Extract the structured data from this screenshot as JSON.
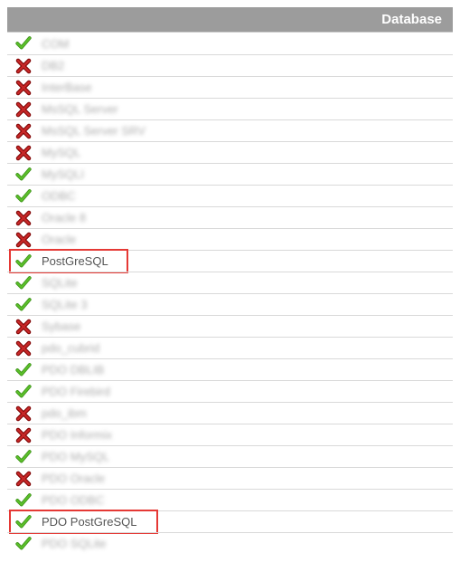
{
  "header": {
    "title": "Database"
  },
  "rows": [
    {
      "status": "ok",
      "label": "COM",
      "blurred": true,
      "highlight": false,
      "hw": 0
    },
    {
      "status": "fail",
      "label": "DB2",
      "blurred": true,
      "highlight": false,
      "hw": 0
    },
    {
      "status": "fail",
      "label": "InterBase",
      "blurred": true,
      "highlight": false,
      "hw": 0
    },
    {
      "status": "fail",
      "label": "MsSQL Server",
      "blurred": true,
      "highlight": false,
      "hw": 0
    },
    {
      "status": "fail",
      "label": "MsSQL Server SRV",
      "blurred": true,
      "highlight": false,
      "hw": 0
    },
    {
      "status": "fail",
      "label": "MySQL",
      "blurred": true,
      "highlight": false,
      "hw": 0
    },
    {
      "status": "ok",
      "label": "MySQLI",
      "blurred": true,
      "highlight": false,
      "hw": 0
    },
    {
      "status": "ok",
      "label": "ODBC",
      "blurred": true,
      "highlight": false,
      "hw": 0
    },
    {
      "status": "fail",
      "label": "Oracle 8",
      "blurred": true,
      "highlight": false,
      "hw": 0
    },
    {
      "status": "fail",
      "label": "Oracle",
      "blurred": true,
      "highlight": false,
      "hw": 0
    },
    {
      "status": "ok",
      "label": "PostGreSQL",
      "blurred": false,
      "highlight": true,
      "hw": 132
    },
    {
      "status": "ok",
      "label": "SQLite",
      "blurred": true,
      "highlight": false,
      "hw": 0
    },
    {
      "status": "ok",
      "label": "SQLite 3",
      "blurred": true,
      "highlight": false,
      "hw": 0
    },
    {
      "status": "fail",
      "label": "Sybase",
      "blurred": true,
      "highlight": false,
      "hw": 0
    },
    {
      "status": "fail",
      "label": "pdo_cubrid",
      "blurred": true,
      "highlight": false,
      "hw": 0
    },
    {
      "status": "ok",
      "label": "PDO DBLIB",
      "blurred": true,
      "highlight": false,
      "hw": 0
    },
    {
      "status": "ok",
      "label": "PDO Firebird",
      "blurred": true,
      "highlight": false,
      "hw": 0
    },
    {
      "status": "fail",
      "label": "pdo_ibm",
      "blurred": true,
      "highlight": false,
      "hw": 0
    },
    {
      "status": "fail",
      "label": "PDO Informix",
      "blurred": true,
      "highlight": false,
      "hw": 0
    },
    {
      "status": "ok",
      "label": "PDO MySQL",
      "blurred": true,
      "highlight": false,
      "hw": 0
    },
    {
      "status": "fail",
      "label": "PDO Oracle",
      "blurred": true,
      "highlight": false,
      "hw": 0
    },
    {
      "status": "ok",
      "label": "PDO ODBC",
      "blurred": true,
      "highlight": false,
      "hw": 0
    },
    {
      "status": "ok",
      "label": "PDO PostGreSQL",
      "blurred": false,
      "highlight": true,
      "hw": 165
    },
    {
      "status": "ok",
      "label": "PDO SQLite",
      "blurred": true,
      "highlight": false,
      "hw": 0
    }
  ],
  "icons": {
    "ok_color": "#5bbf2a",
    "fail_color": "#c62828"
  }
}
